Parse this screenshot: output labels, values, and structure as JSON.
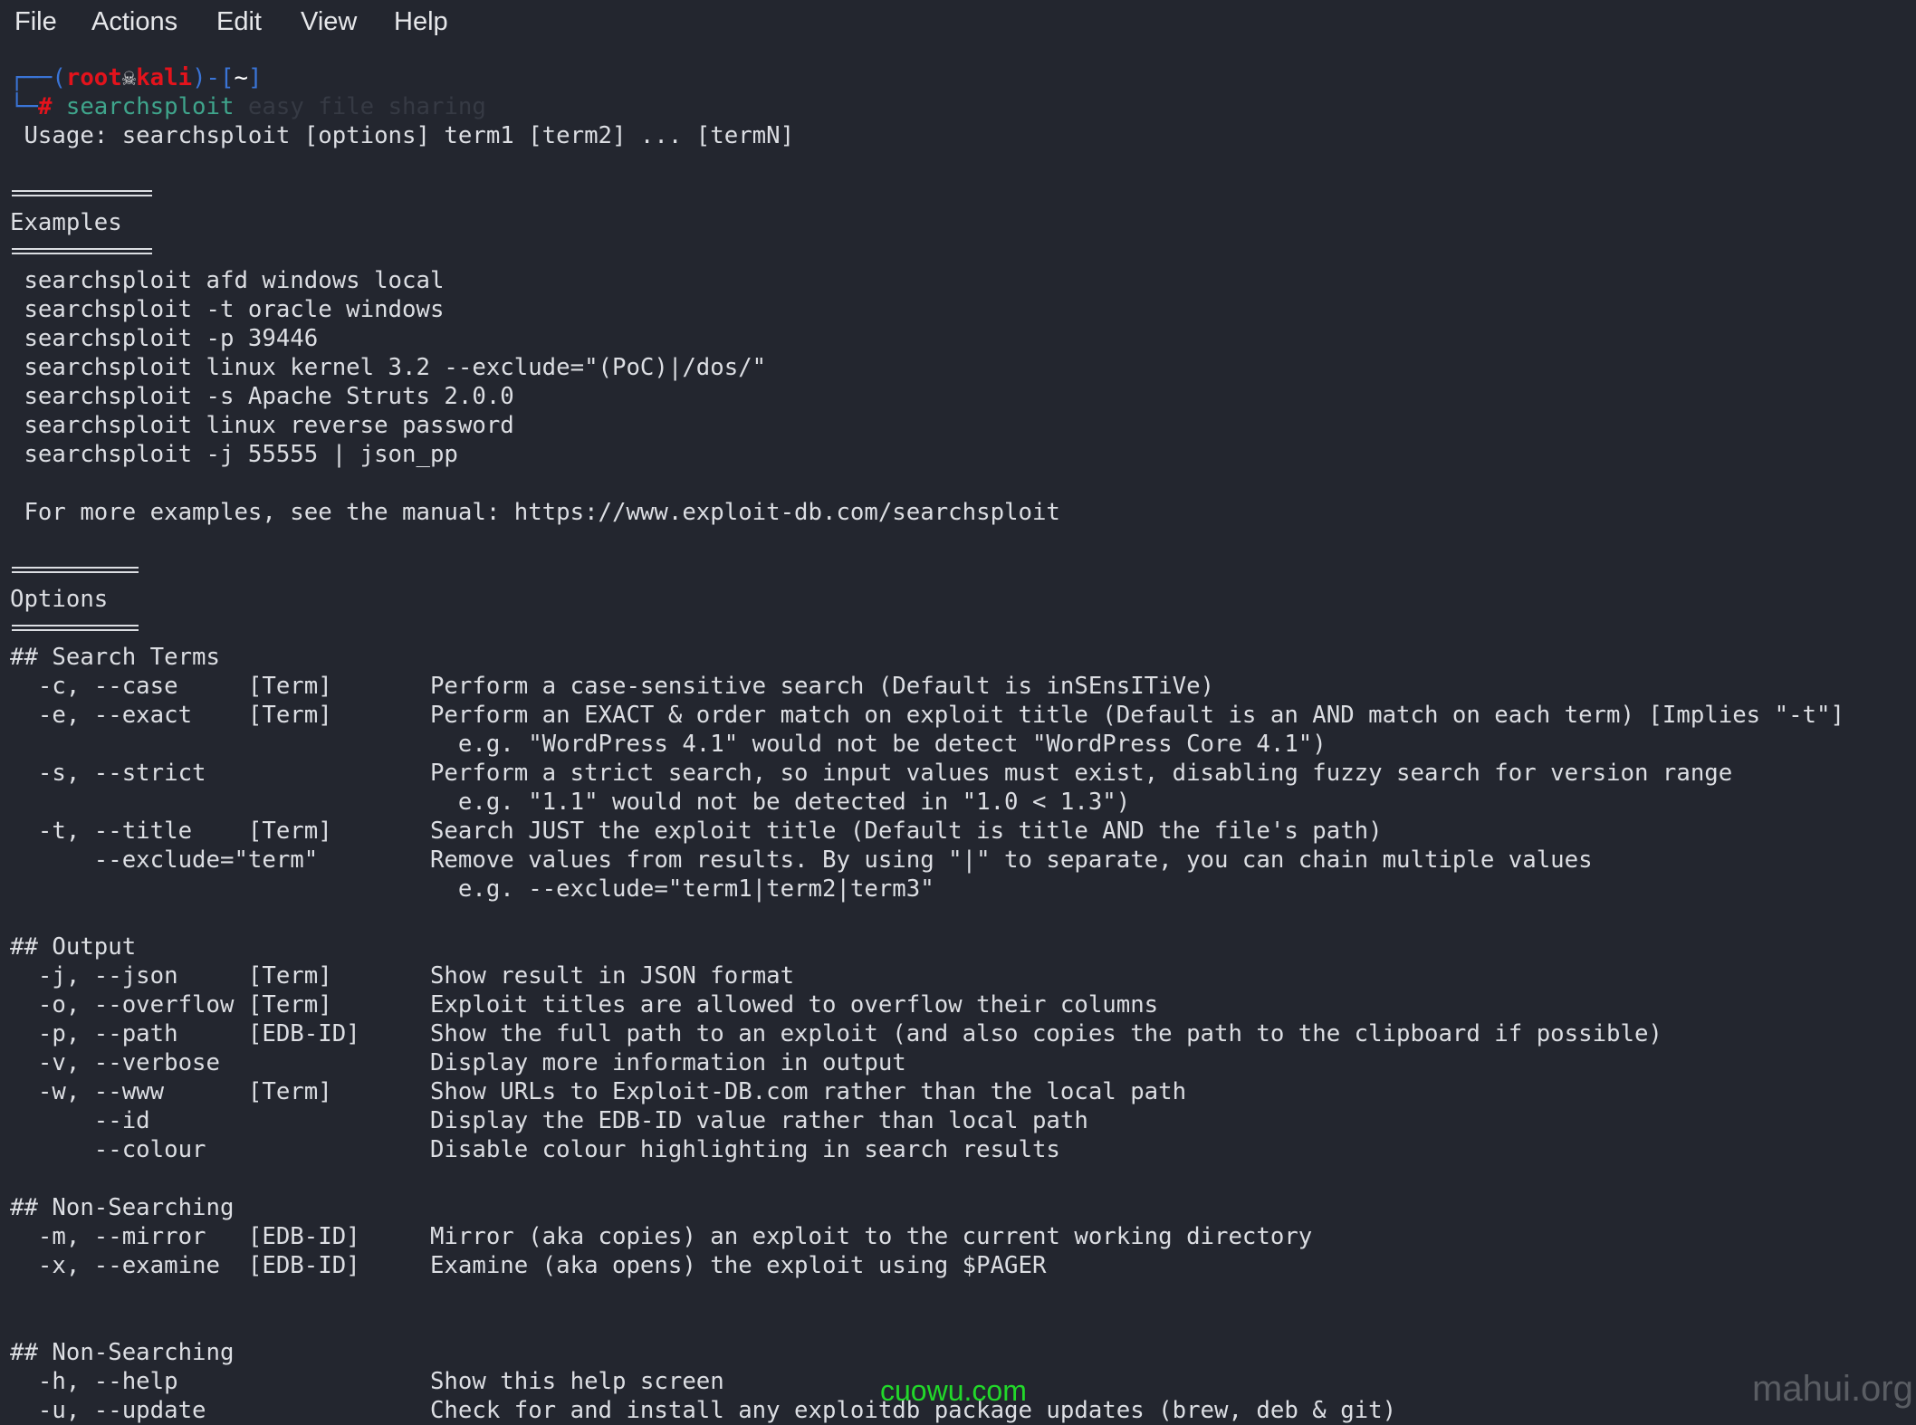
{
  "menu": [
    "File",
    "Actions",
    "Edit",
    "View",
    "Help"
  ],
  "prompt": {
    "frame_top": "┌──(",
    "user": "root",
    "skull": "☠",
    "host": "kali",
    "frame_mid": ")-[",
    "dir": "~",
    "frame_end": "]",
    "frame_bottom": "└─",
    "hash": "#",
    "command": "searchsploit",
    "ghost_suggestion": " easy file sharing"
  },
  "colors": {
    "background": "#23262f",
    "text": "#dcdee3",
    "prompt_frame": "#3a74d6",
    "prompt_user": "#e3131c",
    "command": "#3fa58c"
  },
  "lines": [
    {
      "t": "text",
      "v": " Usage: searchsploit [options] term1 [term2] ... [termN]"
    },
    {
      "t": "blank"
    },
    {
      "t": "rule",
      "chars": 10
    },
    {
      "t": "text",
      "v": "Examples",
      "name": "section-examples"
    },
    {
      "t": "rule",
      "chars": 10
    },
    {
      "t": "text",
      "v": " searchsploit afd windows local"
    },
    {
      "t": "text",
      "v": " searchsploit -t oracle windows"
    },
    {
      "t": "text",
      "v": " searchsploit -p 39446"
    },
    {
      "t": "text",
      "v": " searchsploit linux kernel 3.2 --exclude=\"(PoC)|/dos/\""
    },
    {
      "t": "text",
      "v": " searchsploit -s Apache Struts 2.0.0"
    },
    {
      "t": "text",
      "v": " searchsploit linux reverse password"
    },
    {
      "t": "text",
      "v": " searchsploit -j 55555 | json_pp"
    },
    {
      "t": "blank"
    },
    {
      "t": "text",
      "v": " For more examples, see the manual: https://www.exploit-db.com/searchsploit"
    },
    {
      "t": "blank"
    },
    {
      "t": "rule",
      "chars": 9
    },
    {
      "t": "text",
      "v": "Options",
      "name": "section-options"
    },
    {
      "t": "rule",
      "chars": 9
    },
    {
      "t": "text",
      "v": "## Search Terms"
    },
    {
      "t": "text",
      "v": "  -c, --case     [Term]       Perform a case-sensitive search (Default is inSEnsITiVe)"
    },
    {
      "t": "text",
      "v": "  -e, --exact    [Term]       Perform an EXACT & order match on exploit title (Default is an AND match on each term) [Implies \"-t\"]"
    },
    {
      "t": "text",
      "v": "                                e.g. \"WordPress 4.1\" would not be detect \"WordPress Core 4.1\")"
    },
    {
      "t": "text",
      "v": "  -s, --strict                Perform a strict search, so input values must exist, disabling fuzzy search for version range"
    },
    {
      "t": "text",
      "v": "                                e.g. \"1.1\" would not be detected in \"1.0 < 1.3\")"
    },
    {
      "t": "text",
      "v": "  -t, --title    [Term]       Search JUST the exploit title (Default is title AND the file's path)"
    },
    {
      "t": "text",
      "v": "      --exclude=\"term\"        Remove values from results. By using \"|\" to separate, you can chain multiple values"
    },
    {
      "t": "text",
      "v": "                                e.g. --exclude=\"term1|term2|term3\""
    },
    {
      "t": "blank"
    },
    {
      "t": "text",
      "v": "## Output"
    },
    {
      "t": "text",
      "v": "  -j, --json     [Term]       Show result in JSON format"
    },
    {
      "t": "text",
      "v": "  -o, --overflow [Term]       Exploit titles are allowed to overflow their columns"
    },
    {
      "t": "text",
      "v": "  -p, --path     [EDB-ID]     Show the full path to an exploit (and also copies the path to the clipboard if possible)"
    },
    {
      "t": "text",
      "v": "  -v, --verbose               Display more information in output"
    },
    {
      "t": "text",
      "v": "  -w, --www      [Term]       Show URLs to Exploit-DB.com rather than the local path"
    },
    {
      "t": "text",
      "v": "      --id                    Display the EDB-ID value rather than local path"
    },
    {
      "t": "text",
      "v": "      --colour                Disable colour highlighting in search results"
    },
    {
      "t": "blank"
    },
    {
      "t": "text",
      "v": "## Non-Searching"
    },
    {
      "t": "text",
      "v": "  -m, --mirror   [EDB-ID]     Mirror (aka copies) an exploit to the current working directory"
    },
    {
      "t": "text",
      "v": "  -x, --examine  [EDB-ID]     Examine (aka opens) the exploit using $PAGER"
    },
    {
      "t": "blank"
    },
    {
      "t": "blank"
    },
    {
      "t": "text",
      "v": "## Non-Searching"
    },
    {
      "t": "text",
      "v": "  -h, --help                  Show this help screen"
    },
    {
      "t": "text",
      "v": "  -u, --update                Check for and install any exploitdb package updates (brew, deb & git)"
    }
  ],
  "watermarks": {
    "center": "cuowu.com",
    "corner": "mahui.org"
  }
}
